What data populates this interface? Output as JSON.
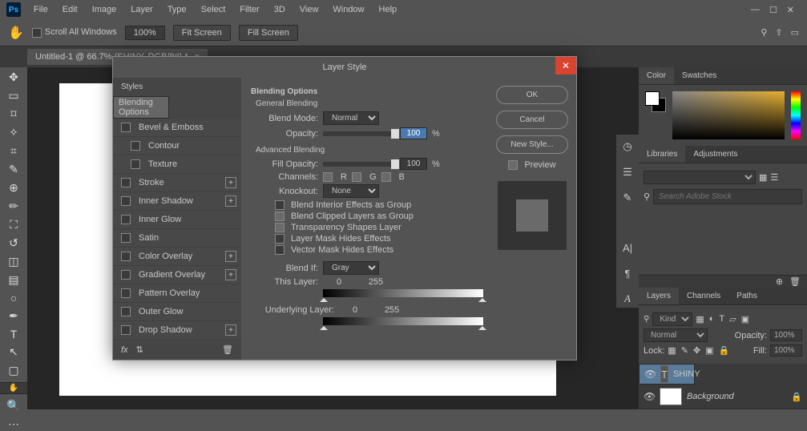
{
  "app": {
    "icon": "Ps"
  },
  "menu": [
    "File",
    "Edit",
    "Image",
    "Layer",
    "Type",
    "Select",
    "Filter",
    "3D",
    "View",
    "Window",
    "Help"
  ],
  "options": {
    "scroll_all": "Scroll All Windows",
    "zoom": "100%",
    "fit": "Fit Screen",
    "fill": "Fill Screen"
  },
  "doc_tab": "Untitled-1 @ 66.7% (SHINY, RGB/8#) *",
  "dialog": {
    "title": "Layer Style",
    "styles_header": "Styles",
    "styles": [
      {
        "label": "Blending Options",
        "sel": true
      },
      {
        "label": "Bevel & Emboss",
        "chk": true
      },
      {
        "label": "Contour",
        "chk": true,
        "sub": true
      },
      {
        "label": "Texture",
        "chk": true,
        "sub": true
      },
      {
        "label": "Stroke",
        "chk": true,
        "plus": true
      },
      {
        "label": "Inner Shadow",
        "chk": true,
        "plus": true
      },
      {
        "label": "Inner Glow",
        "chk": true
      },
      {
        "label": "Satin",
        "chk": true
      },
      {
        "label": "Color Overlay",
        "chk": true,
        "plus": true
      },
      {
        "label": "Gradient Overlay",
        "chk": true,
        "plus": true
      },
      {
        "label": "Pattern Overlay",
        "chk": true
      },
      {
        "label": "Outer Glow",
        "chk": true
      },
      {
        "label": "Drop Shadow",
        "chk": true,
        "plus": true
      }
    ],
    "blend": {
      "heading": "Blending Options",
      "general": "General Blending",
      "mode_label": "Blend Mode:",
      "mode": "Normal",
      "opacity_label": "Opacity:",
      "opacity": "100",
      "pct": "%",
      "advanced": "Advanced Blending",
      "fill_label": "Fill Opacity:",
      "fill": "100",
      "channels_label": "Channels:",
      "ch_r": "R",
      "ch_g": "G",
      "ch_b": "B",
      "knockout_label": "Knockout:",
      "knockout": "None",
      "cb1": "Blend Interior Effects as Group",
      "cb2": "Blend Clipped Layers as Group",
      "cb3": "Transparency Shapes Layer",
      "cb4": "Layer Mask Hides Effects",
      "cb5": "Vector Mask Hides Effects",
      "blendif_label": "Blend If:",
      "blendif": "Gray",
      "this_layer": "This Layer:",
      "under_layer": "Underlying Layer:",
      "range_lo": "0",
      "range_hi": "255"
    },
    "buttons": {
      "ok": "OK",
      "cancel": "Cancel",
      "new": "New Style...",
      "preview": "Preview"
    }
  },
  "panels": {
    "color": "Color",
    "swatches": "Swatches",
    "libraries": "Libraries",
    "adjustments": "Adjustments",
    "search_ph": "Search Adobe Stock",
    "layers": "Layers",
    "channels": "Channels",
    "paths": "Paths",
    "kind": "Kind",
    "blend": "Normal",
    "opacity_lbl": "Opacity:",
    "opacity": "100%",
    "lock": "Lock:",
    "fill_lbl": "Fill:",
    "fill": "100%",
    "layer1": "SHINY",
    "layer2": "Background"
  }
}
